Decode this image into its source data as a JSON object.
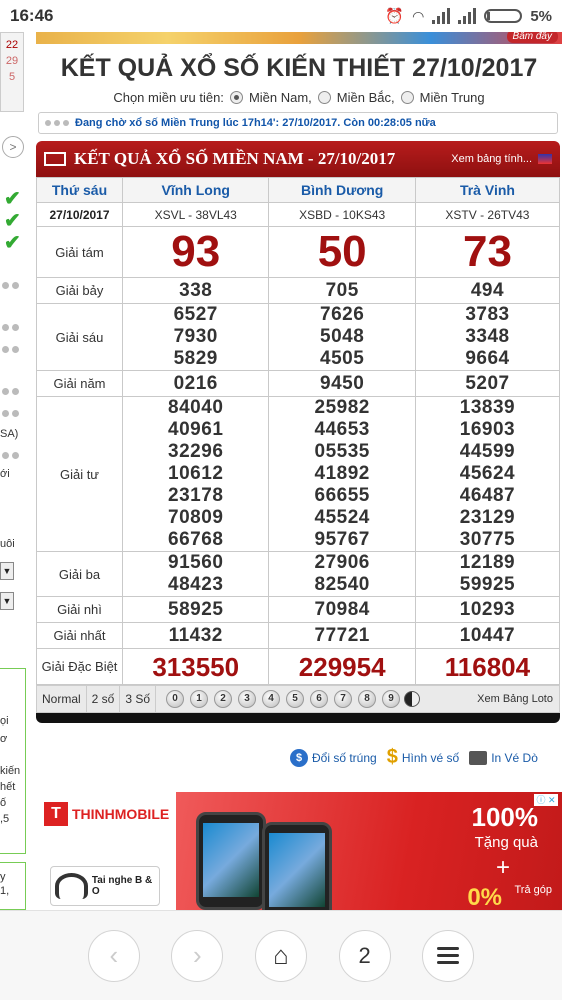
{
  "status": {
    "time": "16:46",
    "battery": "5%"
  },
  "left_strip": {
    "dates": [
      "22",
      "29",
      "5"
    ],
    "texts": [
      "SA)",
      "ới",
      "uôi",
      "ọi",
      "ơ",
      "kiến",
      "hết",
      "ố",
      ",5",
      "y",
      "1,",
      "en."
    ]
  },
  "page_title": "KẾT QUẢ XỔ SỐ KIẾN THIẾT 27/10/2017",
  "region": {
    "label": "Chọn miền ưu tiên:",
    "options": [
      "Miền Nam,",
      "Miền Bắc,",
      "Miền Trung"
    ]
  },
  "banner_label": "Bấm đây",
  "waiting_text": "Đang chờ xổ số Miền Trung lúc 17h14': 27/10/2017. Còn 00:28:05 nữa",
  "card": {
    "title": "KẾT QUẢ XỔ SỐ MIỀN NAM - 27/10/2017",
    "view_link": "Xem bảng tính..."
  },
  "table": {
    "day": "Thứ sáu",
    "date": "27/10/2017",
    "provinces": [
      "Vĩnh Long",
      "Bình Dương",
      "Trà Vinh"
    ],
    "codes": [
      "XSVL - 38VL43",
      "XSBD - 10KS43",
      "XSTV - 26TV43"
    ],
    "prizes": [
      {
        "label": "Giải tám",
        "values": [
          [
            "93"
          ],
          [
            "50"
          ],
          [
            "73"
          ]
        ]
      },
      {
        "label": "Giải bảy",
        "values": [
          [
            "338"
          ],
          [
            "705"
          ],
          [
            "494"
          ]
        ]
      },
      {
        "label": "Giải sáu",
        "values": [
          [
            "6527",
            "7930",
            "5829"
          ],
          [
            "7626",
            "5048",
            "4505"
          ],
          [
            "3783",
            "3348",
            "9664"
          ]
        ]
      },
      {
        "label": "Giải năm",
        "values": [
          [
            "0216"
          ],
          [
            "9450"
          ],
          [
            "5207"
          ]
        ]
      },
      {
        "label": "Giải tư",
        "values": [
          [
            "84040",
            "40961",
            "32296",
            "10612",
            "23178",
            "70809",
            "66768"
          ],
          [
            "25982",
            "44653",
            "05535",
            "41892",
            "66655",
            "45524",
            "95767"
          ],
          [
            "13839",
            "16903",
            "44599",
            "45624",
            "46487",
            "23129",
            "30775"
          ]
        ]
      },
      {
        "label": "Giải ba",
        "values": [
          [
            "91560",
            "48423"
          ],
          [
            "27906",
            "82540"
          ],
          [
            "12189",
            "59925"
          ]
        ]
      },
      {
        "label": "Giải nhì",
        "values": [
          [
            "58925"
          ],
          [
            "70984"
          ],
          [
            "10293"
          ]
        ]
      },
      {
        "label": "Giải nhất",
        "values": [
          [
            "11432"
          ],
          [
            "77721"
          ],
          [
            "10447"
          ]
        ]
      },
      {
        "label": "Giải Đặc Biệt",
        "values": [
          [
            "313550"
          ],
          [
            "229954"
          ],
          [
            "116804"
          ]
        ]
      }
    ]
  },
  "controls": {
    "tabs": [
      "Normal",
      "2 số",
      "3 Số"
    ],
    "digits": [
      "0",
      "1",
      "2",
      "3",
      "4",
      "5",
      "6",
      "7",
      "8",
      "9"
    ],
    "loto": "Xem Bảng Loto"
  },
  "links": [
    "Đổi số trúng",
    "Hình vé số",
    "In Vé Dò"
  ],
  "ad": {
    "brand": "THINHMOBILE",
    "offer_pct": "100%",
    "offer_text": "Tặng quà",
    "plus": "+",
    "zero": "0%",
    "tra": "Trả góp",
    "headphones": "Tai nghe B & O",
    "info": "ⓘ ✕"
  },
  "nav": {
    "tab_count": "2"
  },
  "colors": {
    "accent_red": "#a01010",
    "link_blue": "#1a5ba8",
    "header_red": "#b71c1c"
  }
}
